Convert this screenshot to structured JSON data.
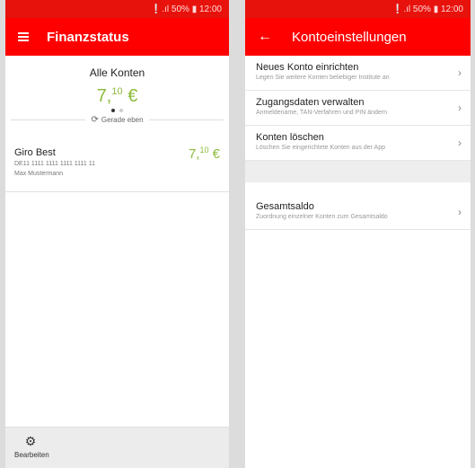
{
  "status": {
    "text": "❕.ıl 50% ▮ 12:00"
  },
  "left": {
    "title": "Finanzstatus",
    "summary": {
      "label": "Alle Konten",
      "amount_main": "7,",
      "amount_sup": "10",
      "currency": "€",
      "refresh": "Gerade eben"
    },
    "account": {
      "name": "Giro Best",
      "iban": "DE11 1111 1111 1111 1111 11",
      "owner": "Max Mustermann",
      "amount_main": "7,",
      "amount_sup": "10",
      "currency": "€"
    },
    "bottom": {
      "edit_label": "Bearbeiten"
    }
  },
  "right": {
    "title": "Kontoeinstellungen",
    "items": [
      {
        "title": "Neues Konto einrichten",
        "sub": "Legen Sie weitere Konten beliebiger Institute an"
      },
      {
        "title": "Zugangsdaten verwalten",
        "sub": "Anmeldename, TAN-Verfahren und PIN ändern"
      },
      {
        "title": "Konten löschen",
        "sub": "Löschen Sie eingerichtete Konten aus der App"
      },
      {
        "title": "Gesamtsaldo",
        "sub": "Zuordnung einzelner Konten zum Gesamtsaldo"
      }
    ]
  },
  "colors": {
    "brand": "#ff0000",
    "amount": "#8dbb3c"
  },
  "icons": [
    "menu-icon",
    "back-icon",
    "refresh-icon",
    "gear-icon",
    "chevron-right-icon"
  ]
}
